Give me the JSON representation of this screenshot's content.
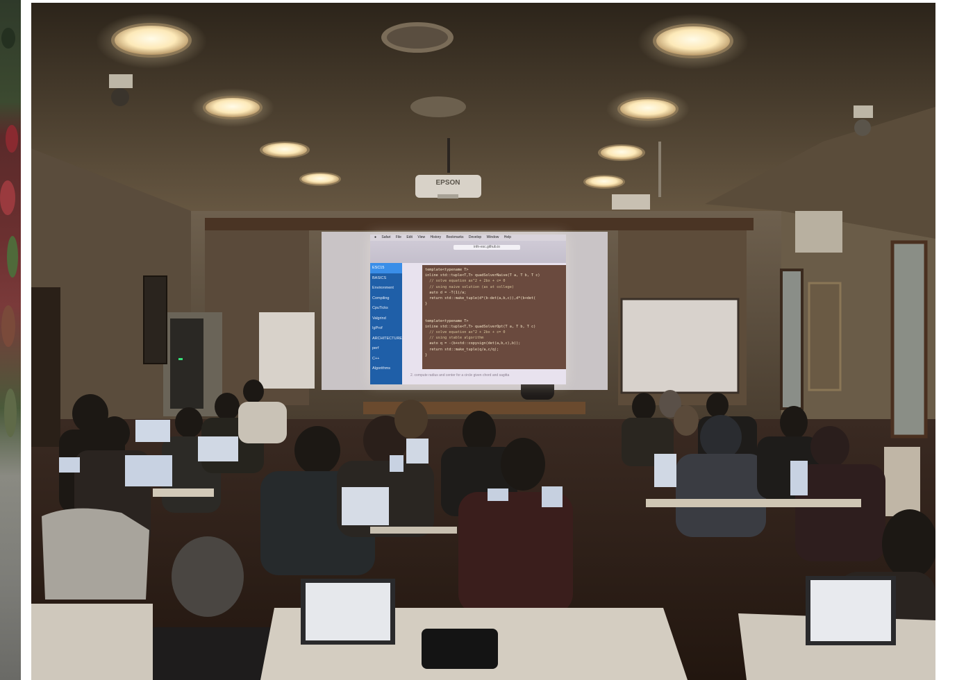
{
  "projector": {
    "brand": "EPSON"
  },
  "slide": {
    "menubar": [
      "Safari",
      "File",
      "Edit",
      "View",
      "History",
      "Bookmarks",
      "Develop",
      "Window",
      "Help"
    ],
    "url": "infn-esc.github.io",
    "sidebar": [
      "ESC15",
      "BASICS",
      "Environment",
      "Compiling",
      "CpuTicks",
      "Valgrind",
      "IgProf",
      "ARCHITECTURE",
      "perf",
      "C++",
      "Algorithms"
    ],
    "active_item": "ESC15",
    "code": [
      "template<typename T>",
      "inline std::tuple<T,T> quadSolverNaive(T a, T b, T c)",
      "  // solve equation ax^2 + 2bx + c= 0",
      "  // using naive solution (as at college)",
      "  auto d = -T(1)/a;",
      "  return std::make_tuple(d*(b-det(a,b,c)),d*(b+det(",
      "}",
      "",
      "",
      "template<typename T>",
      "inline std::tuple<T,T> quadSolverOpt(T a, T b, T c)",
      "  // solve equation ax^2 + 2bx + c= 0",
      "  // using stable algorithm",
      "  auto q = -(b+std::copysign(det(a,b,c),b));",
      "  return std::make_tuple(q/a,c/q);",
      "}"
    ],
    "footer": "2.  compute radius and center for a circle given chord and sagitta"
  }
}
